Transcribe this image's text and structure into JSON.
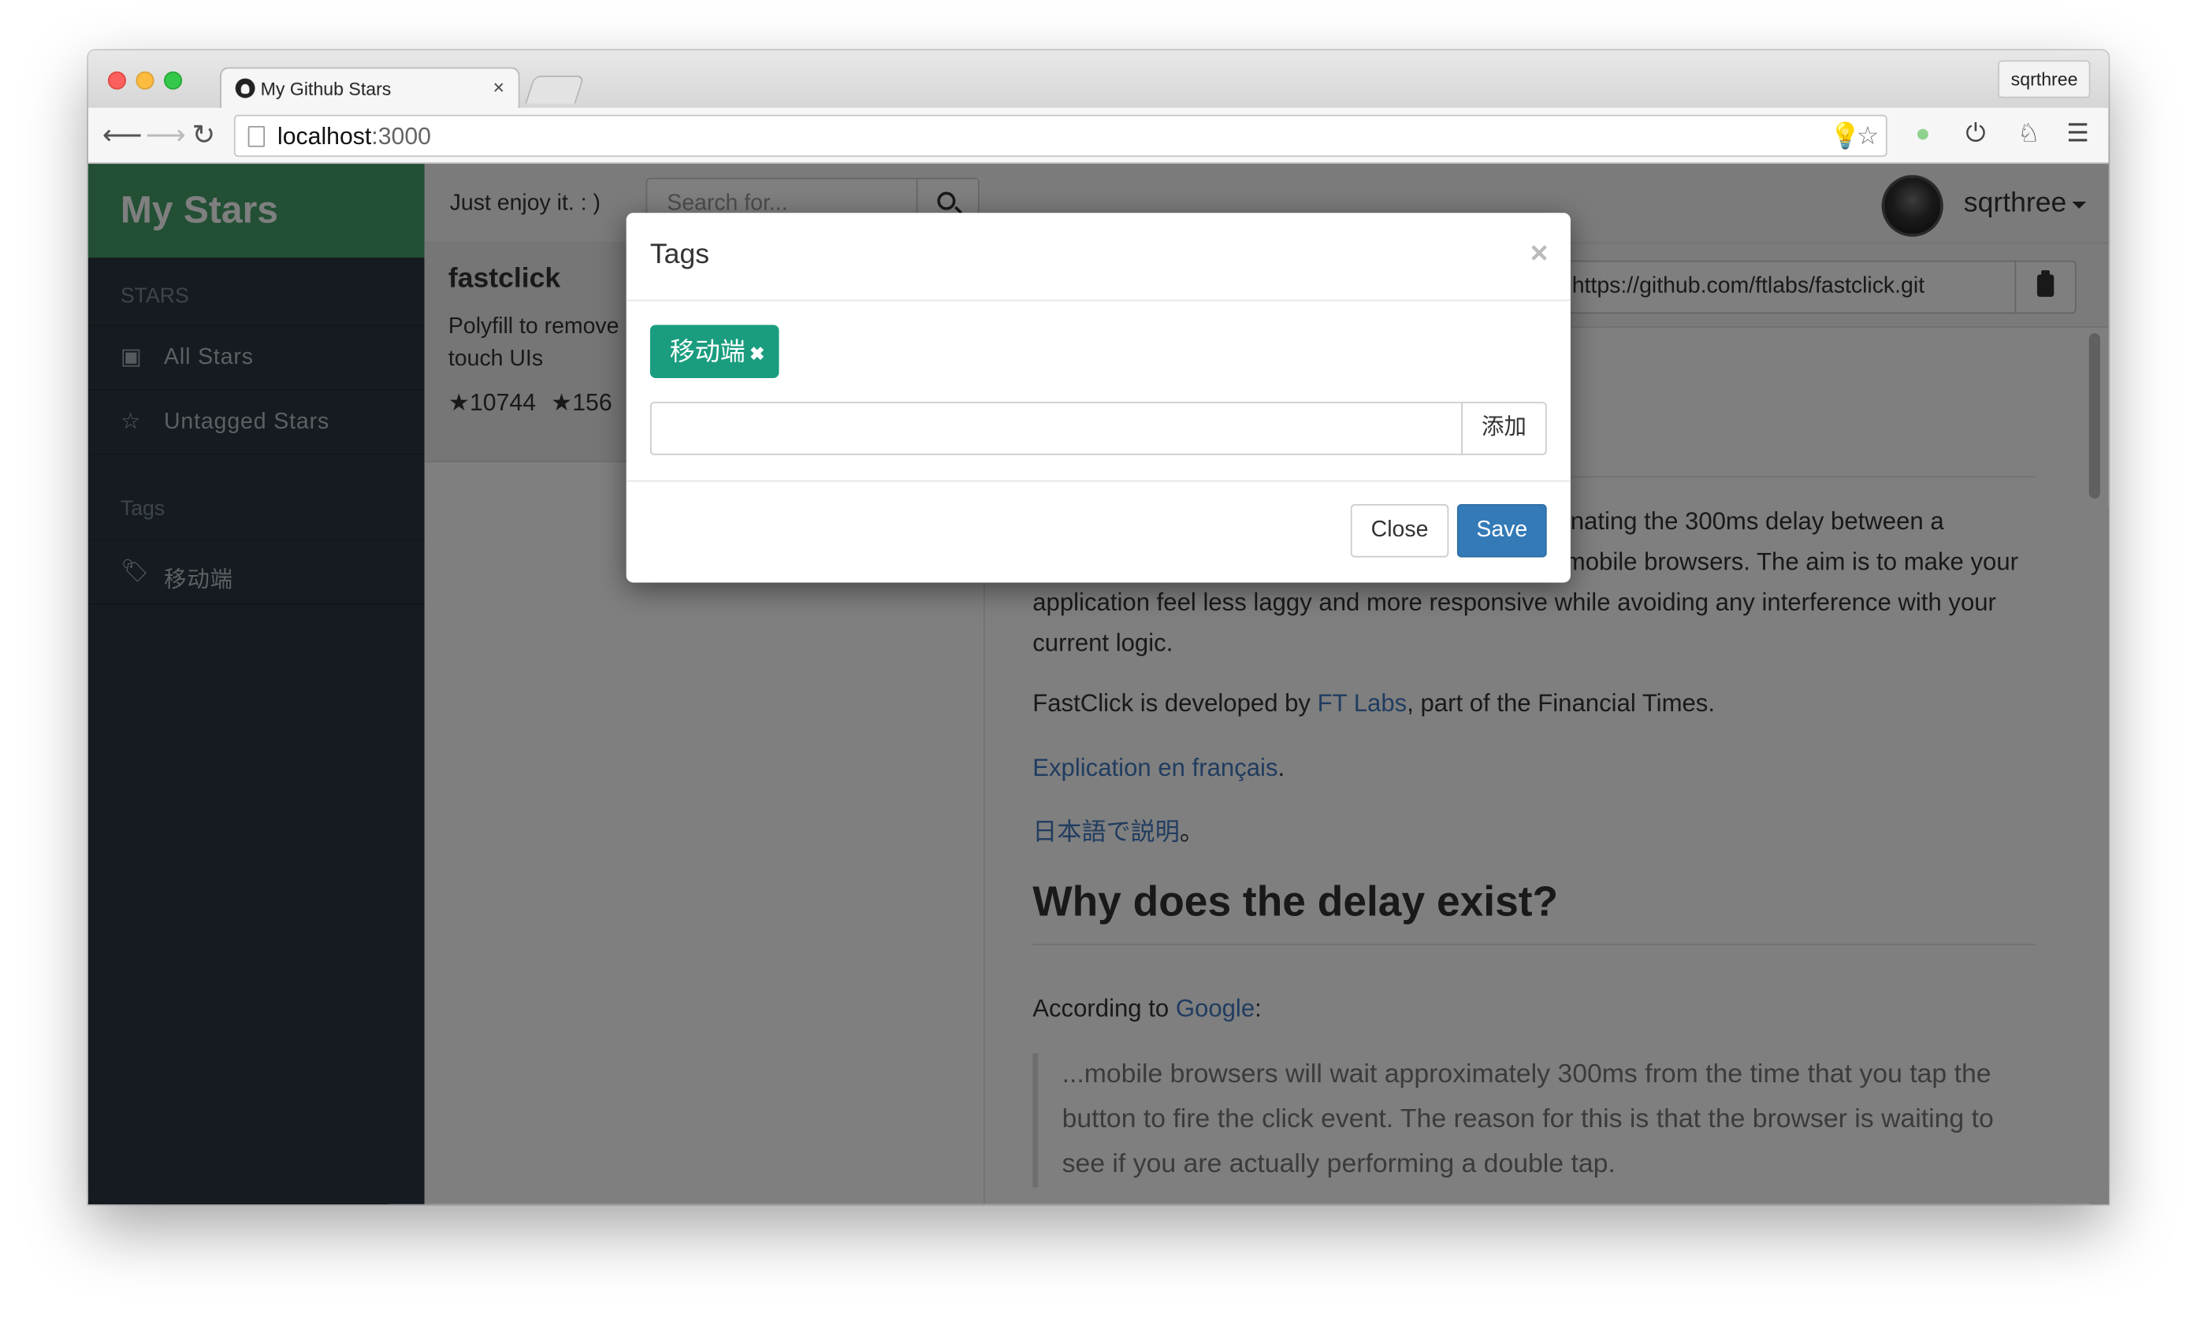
{
  "browser": {
    "tab_title": "My Github Stars",
    "tab_close": "×",
    "profile_name": "sqrthree",
    "url_host": "localhost",
    "url_port": ":3000"
  },
  "sidebar": {
    "brand": "My Stars",
    "stars_heading": "STARS",
    "items": [
      {
        "label": "All   Stars",
        "icon": "inbox-icon"
      },
      {
        "label": "Untagged   Stars",
        "icon": "star-outline-icon"
      }
    ],
    "tags_heading": "Tags",
    "tags": [
      {
        "label": "移动端",
        "icon": "tag-icon"
      }
    ]
  },
  "topbar": {
    "tagline": "Just enjoy it. : )",
    "search_placeholder": "Search for...",
    "username": "sqrthree"
  },
  "repo": {
    "name": "fastclick",
    "description": "Polyfill to remove click delays on browsers with touch UIs",
    "stars": "★10744",
    "forks": "★156"
  },
  "detail": {
    "clone_url": "https://github.com/ftlabs/fastclick.git",
    "p1": "FastClick is a simple, easy-to-use library for eliminating the 300ms delay between a physical tap and the firing of a click event on mobile browsers. The aim is to make your application feel less laggy and more responsive while avoiding any interference with your current logic.",
    "p1_visible_line1": "inating the 300ms delay between a",
    "p1_visible_line2": "mobile browsers. The aim is to make your",
    "p1_visible_line3": "application feel less laggy and more responsive while avoiding any interference with your",
    "p1_visible_line4": "current logic.",
    "p2_prefix": "FastClick is developed by ",
    "p2_link": "FT Labs",
    "p2_suffix": ", part of the Financial Times.",
    "p3_link": "Explication en français",
    "p3_suffix": ".",
    "p4_link": "日本語で説明",
    "p4_suffix": "。",
    "h2": "Why does the delay exist?",
    "p5_prefix": "According to ",
    "p5_link": "Google",
    "p5_suffix": ":",
    "quote": "...mobile browsers will wait approximately 300ms from the time that you tap the button to fire the click event. The reason for this is that the browser is waiting to see if you are actually performing a double tap."
  },
  "modal": {
    "title": "Tags",
    "close_glyph": "×",
    "tag": "移动端",
    "tag_remove": "✖",
    "input_value": "",
    "add_label": "添加",
    "close_label": "Close",
    "save_label": "Save"
  },
  "colors": {
    "brand_green": "#47a06b",
    "sidebar_bg": "#2a3640",
    "tag_teal": "#1a9d7f",
    "primary_blue": "#337ab7",
    "link_blue": "#4078c0"
  }
}
